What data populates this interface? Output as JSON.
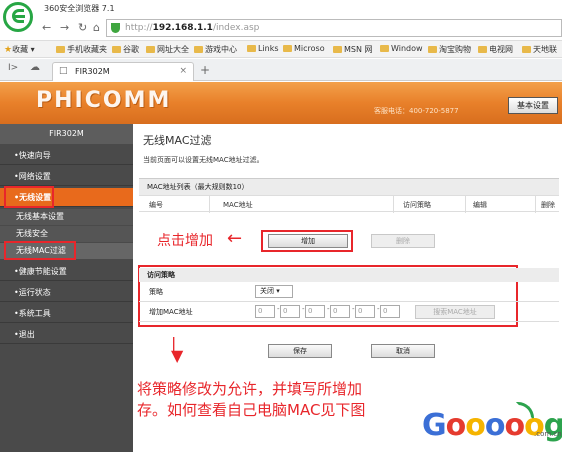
{
  "browser": {
    "title": "360安全浏览器 7.1",
    "url_prefix": "http://",
    "url_host": "192.168.1.1",
    "url_path": "/index.asp",
    "bookmarks": [
      "收藏",
      "手机收藏夹",
      "谷歌",
      "网址大全",
      "游戏中心",
      "Links",
      "Microso",
      "MSN 网",
      "Window",
      "淘宝购物",
      "电视网",
      "天地联"
    ],
    "tab_title": "FIR302M",
    "new_tab": "+"
  },
  "router": {
    "brand": "PHICOMM",
    "hotline": "客服电话：400-720-5877",
    "basic_settings": "基本设置",
    "model": "FIR302M",
    "nav": [
      "快速向导",
      "网络设置",
      "无线设置",
      "健康节能设置",
      "运行状态",
      "系统工具",
      "退出"
    ],
    "wireless_sub": [
      "无线基本设置",
      "无线安全",
      "无线MAC过滤"
    ]
  },
  "main": {
    "title": "无线MAC过滤",
    "description": "当前页面可以设置无线MAC地址过滤。",
    "list_header": "MAC地址列表（最大规则数10）",
    "columns": [
      "编号",
      "MAC地址",
      "访问策略",
      "编辑",
      "删除"
    ],
    "add_button": "增加",
    "delete_all_button": "删除",
    "annotation_click": "点击增加",
    "policy_header": "访问策略",
    "policy_label": "策略",
    "policy_value": "关闭",
    "add_mac_label": "增加MAC地址",
    "mac_segments": [
      "0",
      "0",
      "0",
      "0",
      "0",
      "0"
    ],
    "search_mac_button": "搜索MAC地址",
    "save_button": "保存",
    "cancel_button": "取消",
    "instruction_line1": "将策略修改为允许，并填写所增加",
    "instruction_line2": "存。如何查看自己电脑MAC见下图"
  },
  "watermark": {
    "domain_suffix": ".com.cn"
  }
}
